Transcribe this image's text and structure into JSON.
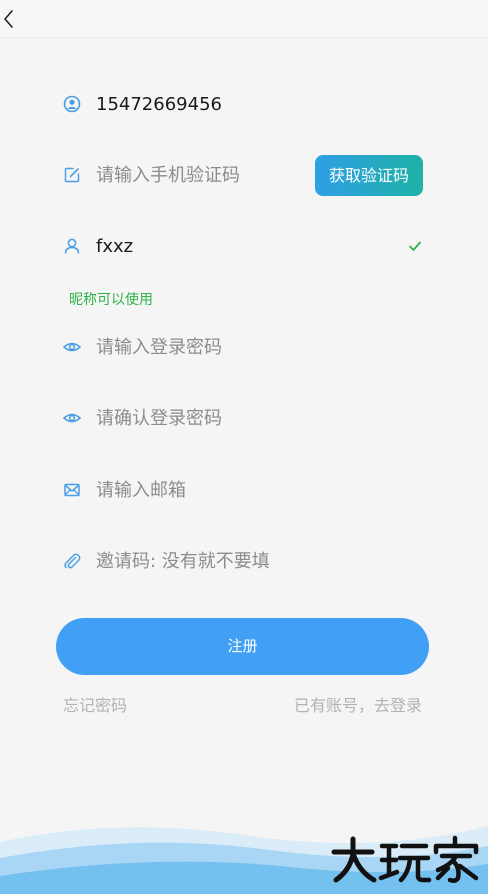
{
  "header": {
    "back_icon": "chevron-left-icon"
  },
  "form": {
    "phone": {
      "value": "15472669456",
      "icon": "user-circle-icon"
    },
    "code": {
      "placeholder": "请输入手机验证码",
      "icon": "edit-icon",
      "button_label": "获取验证码"
    },
    "nickname": {
      "value": "fxxz",
      "icon": "user-icon",
      "status_icon": "check-icon",
      "status_text": "昵称可以使用"
    },
    "password": {
      "placeholder": "请输入登录密码",
      "icon": "eye-icon"
    },
    "confirm_password": {
      "placeholder": "请确认登录密码",
      "icon": "eye-icon"
    },
    "email": {
      "placeholder": "请输入邮箱",
      "icon": "mail-icon"
    },
    "invite": {
      "placeholder": "邀请码: 没有就不要填",
      "icon": "paperclip-icon"
    }
  },
  "actions": {
    "register_label": "注册",
    "forgot_label": "忘记密码",
    "login_label": "已有账号，去登录"
  },
  "footer": {
    "watermark_text": "大玩家"
  },
  "colors": {
    "accent": "#419ff5",
    "icon": "#4a9ee6",
    "success": "#2fb24a",
    "code_button_start": "#2f9fe6",
    "code_button_end": "#1eb2a6",
    "muted_text": "#b3b3b3",
    "placeholder": "#8c8c8c"
  }
}
